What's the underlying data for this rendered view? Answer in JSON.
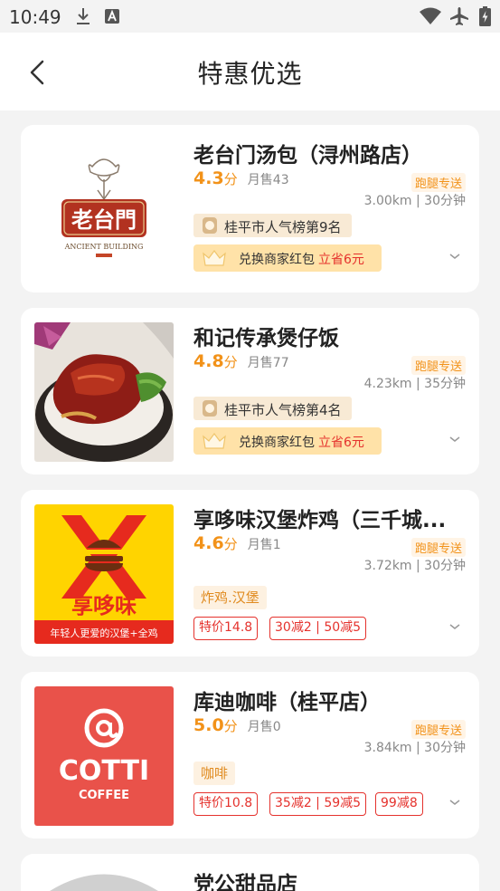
{
  "status_bar": {
    "time": "10:49"
  },
  "header": {
    "title": "特惠优选"
  },
  "stores": [
    {
      "name": "老台门汤包（浔州路店）",
      "rating": "4.3",
      "rating_unit": "分",
      "sales": "月售43",
      "delivery": "跑腿专送",
      "distance": "3.00km | 30分钟",
      "rank": "桂平市人气榜第9名",
      "coupon": "兑换商家红包",
      "coupon_save": "立省6元",
      "logo_text": "老台門",
      "logo_sub": "ANCIENT BUILDING"
    },
    {
      "name": "和记传承煲仔饭",
      "rating": "4.8",
      "rating_unit": "分",
      "sales": "月售77",
      "delivery": "跑腿专送",
      "distance": "4.23km | 35分钟",
      "rank": "桂平市人气榜第4名",
      "coupon": "兑换商家红包",
      "coupon_save": "立省6元"
    },
    {
      "name": "享哆味汉堡炸鸡（三千城...",
      "rating": "4.6",
      "rating_unit": "分",
      "sales": "月售1",
      "delivery": "跑腿专送",
      "distance": "3.72km | 30分钟",
      "category": "炸鸡.汉堡",
      "promos": [
        "特价14.8",
        "30减2 | 50减5"
      ],
      "logo_text": "享哆味",
      "logo_slogan": "年轻人更爱的汉堡+全鸡"
    },
    {
      "name": "库迪咖啡（桂平店）",
      "rating": "5.0",
      "rating_unit": "分",
      "sales": "月售0",
      "delivery": "跑腿专送",
      "distance": "3.84km | 30分钟",
      "category": "咖啡",
      "promos": [
        "特价10.8",
        "35减2 | 59减5",
        "99减8"
      ],
      "logo_text": "COTTI",
      "logo_sub": "COFFEE"
    },
    {
      "name": "党公甜品店"
    }
  ],
  "colors": {
    "accent": "#f29219",
    "promo_red": "#e5322d",
    "coupon_bg": "#ffe2a8"
  }
}
